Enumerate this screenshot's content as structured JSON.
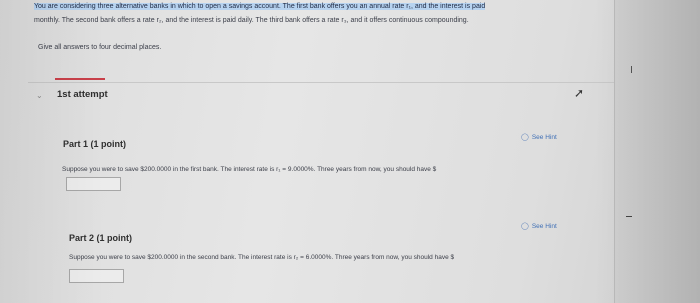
{
  "intro": {
    "line1_highlighted": "You are considering three alternative banks in which to open a savings account. The first bank offers you an annual rate r₁, and the interest is paid",
    "line2": "monthly. The second bank offers a rate r₂, and the interest is paid daily. The third bank offers a rate r₃, and it offers continuous compounding."
  },
  "instructions": "Give all answers to four decimal places.",
  "attempt": {
    "label": "1st attempt"
  },
  "part1": {
    "title": "Part 1  (1 point)",
    "hint": "See Hint",
    "question": "Suppose you were to save $200.0000 in the first bank. The interest rate is r₁ = 9.0000%. Three years from now, you should have $",
    "answer": ""
  },
  "part2": {
    "title": "Part 2  (1 point)",
    "hint": "See Hint",
    "question": "Suppose you were to save $200.0000 in the second bank. The interest rate is r₂ = 6.0000%. Three years from now, you should have $",
    "answer": ""
  },
  "colors": {
    "accent": "#c9404a",
    "hint_link": "#3f6fb5",
    "highlight": "#b7d3f0"
  },
  "icons": {
    "collapse": "chevron-down-icon",
    "expand": "arrow-up-right-icon",
    "hint": "lightbulb-icon"
  }
}
